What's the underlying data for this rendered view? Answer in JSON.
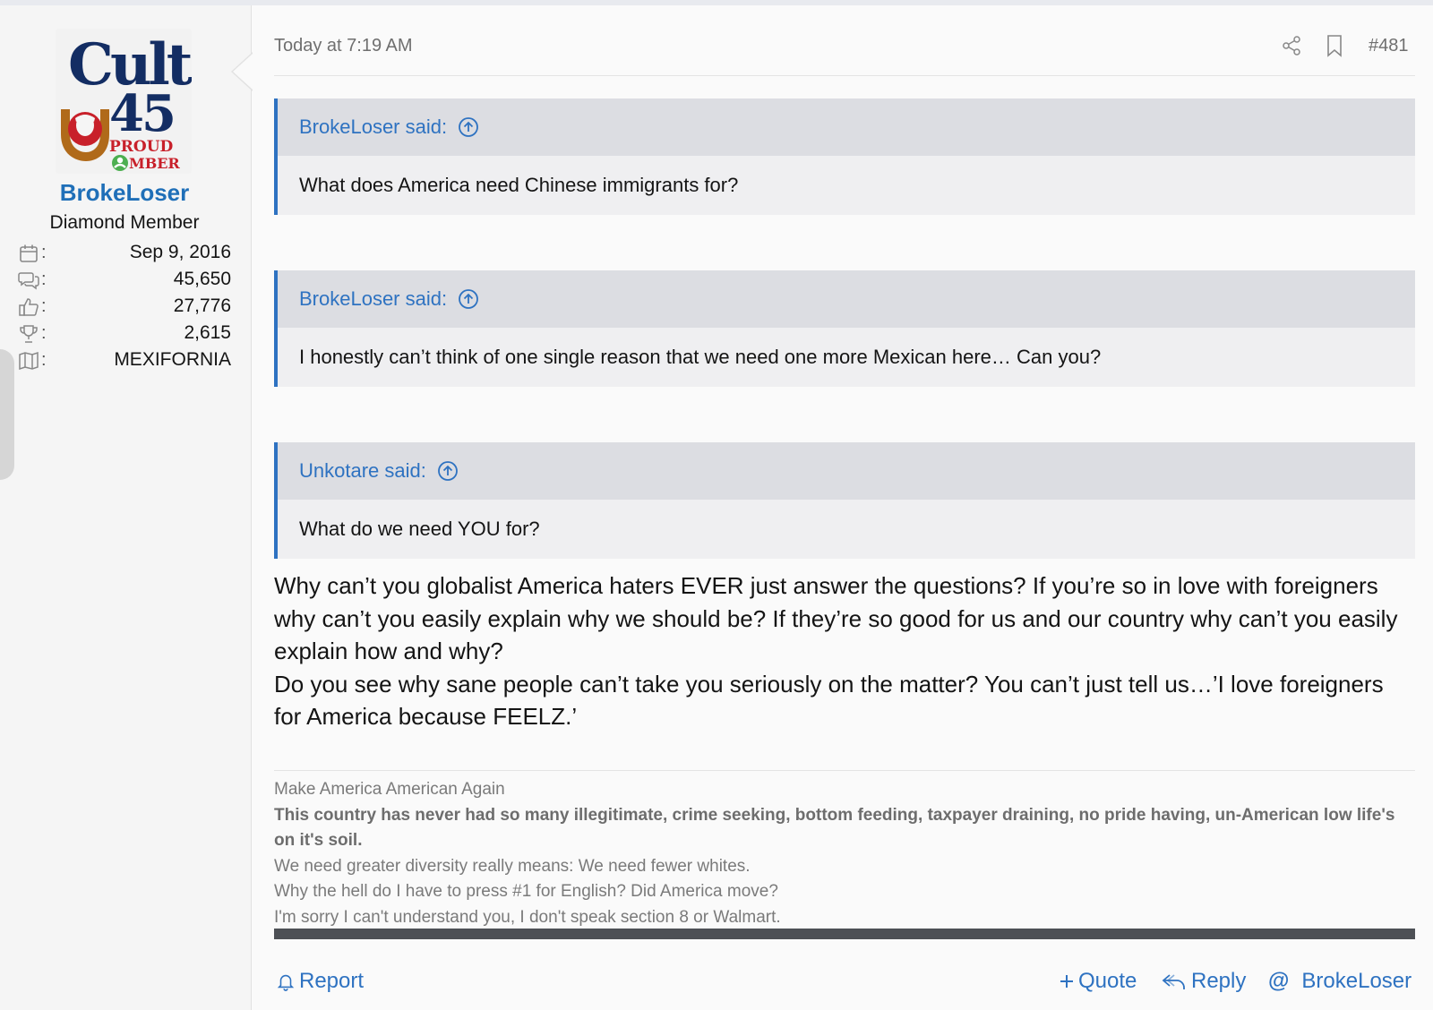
{
  "user": {
    "avatar": {
      "logo_text": "Cult 45",
      "badge_text": "PROUD MEMBER"
    },
    "name": "BrokeLoser",
    "title": "Diamond Member",
    "stats": [
      {
        "icon": "calendar-icon",
        "value": "Sep 9, 2016"
      },
      {
        "icon": "messages-icon",
        "value": "45,650"
      },
      {
        "icon": "thumbs-up-icon",
        "value": "27,776"
      },
      {
        "icon": "trophy-icon",
        "value": "2,615"
      },
      {
        "icon": "map-icon",
        "value": "MEXIFORNIA"
      }
    ],
    "colon": ":"
  },
  "post": {
    "date": "Today at 7:19 AM",
    "number": "#481",
    "quotes": [
      {
        "author": "BrokeLoser said:",
        "text": "What does America need Chinese immigrants for?"
      },
      {
        "author": "BrokeLoser said:",
        "text": "I honestly can’t think of one single reason that we need one more Mexican here… Can you?"
      },
      {
        "author": "Unkotare said:",
        "text": "What do we need YOU for?"
      }
    ],
    "body": [
      "Why can’t you globalist America haters EVER just answer the questions? If you’re so in love with foreigners why can’t you easily explain why we should be? If they’re so good for us and our country why can’t you easily explain how and why?",
      "Do you see why sane people can’t take you seriously on the matter? You can’t just tell us…’I love foreigners for America because FEELZ.’"
    ],
    "signature": {
      "line1": "Make America American Again",
      "line2": "This country has never had so many illegitimate, crime seeking, bottom feeding, taxpayer draining, no pride having, un-American low life's on it's soil.",
      "line3": "We need greater diversity really means: We need fewer whites.",
      "line4": "Why the hell do I have to press #1 for English? Did America move?",
      "line5": "I'm sorry I can't understand you, I don't speak section 8 or Walmart."
    }
  },
  "actions": {
    "report": "Report",
    "quote": "Quote",
    "reply": "Reply",
    "mention": "BrokeLoser"
  },
  "colors": {
    "link": "#2e72c1",
    "username": "#1f6fb8",
    "quote_header_bg": "#dcdde2",
    "quote_body_bg": "#efeff1"
  }
}
